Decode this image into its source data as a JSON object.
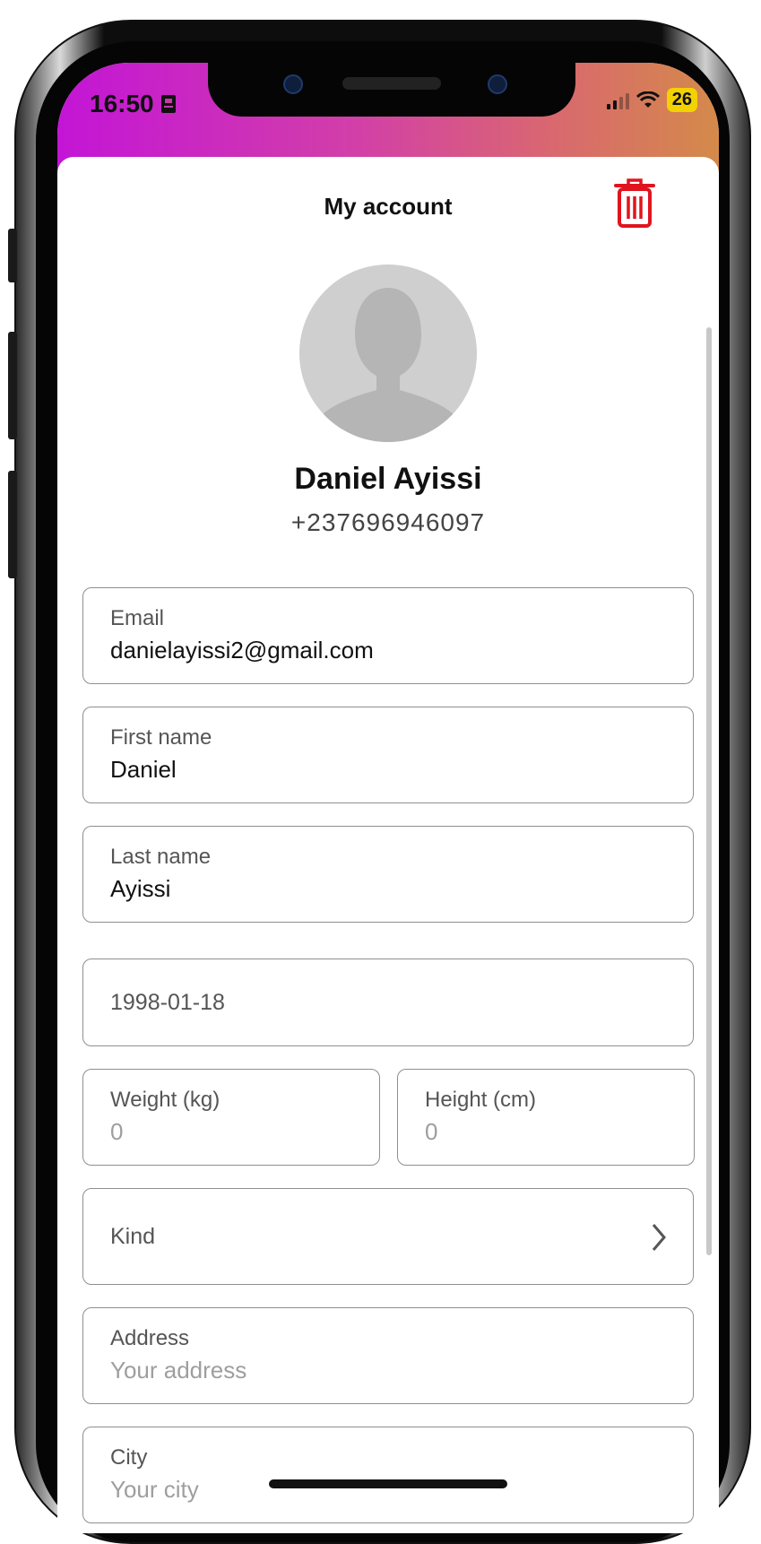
{
  "status_bar": {
    "time": "16:50",
    "battery": "26"
  },
  "header": {
    "title": "My account"
  },
  "profile": {
    "name": "Daniel Ayissi",
    "phone": "+237696946097"
  },
  "form": {
    "email": {
      "label": "Email",
      "value": "danielayissi2@gmail.com"
    },
    "first_name": {
      "label": "First name",
      "value": "Daniel"
    },
    "last_name": {
      "label": "Last name",
      "value": "Ayissi"
    },
    "birth_date": {
      "value": "1998-01-18"
    },
    "weight": {
      "label": "Weight (kg)",
      "placeholder": "0"
    },
    "height": {
      "label": "Height (cm)",
      "placeholder": "0"
    },
    "kind": {
      "label": "Kind"
    },
    "address": {
      "label": "Address",
      "placeholder": "Your address"
    },
    "city": {
      "label": "City",
      "placeholder": "Your city"
    }
  },
  "colors": {
    "status_gradient_start": "#c315d6",
    "status_gradient_end": "#d48a4a",
    "trash_red": "#e0141e",
    "battery_yellow": "#f2d200"
  }
}
